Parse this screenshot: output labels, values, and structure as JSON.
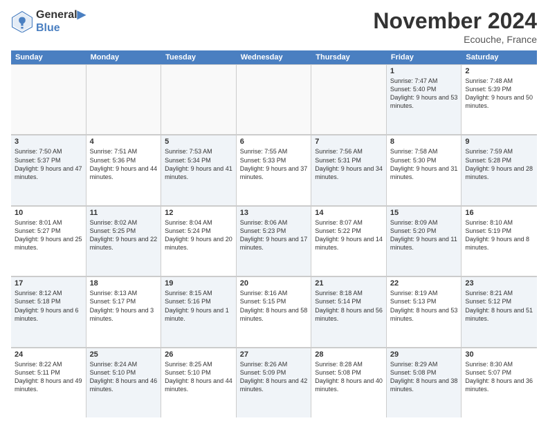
{
  "header": {
    "logo_line1": "General",
    "logo_line2": "Blue",
    "month_title": "November 2024",
    "location": "Ecouche, France"
  },
  "weekdays": [
    "Sunday",
    "Monday",
    "Tuesday",
    "Wednesday",
    "Thursday",
    "Friday",
    "Saturday"
  ],
  "weeks": [
    [
      {
        "day": "",
        "info": "",
        "empty": true
      },
      {
        "day": "",
        "info": "",
        "empty": true
      },
      {
        "day": "",
        "info": "",
        "empty": true
      },
      {
        "day": "",
        "info": "",
        "empty": true
      },
      {
        "day": "",
        "info": "",
        "empty": true
      },
      {
        "day": "1",
        "info": "Sunrise: 7:47 AM\nSunset: 5:40 PM\nDaylight: 9 hours and 53 minutes.",
        "empty": false,
        "shaded": true
      },
      {
        "day": "2",
        "info": "Sunrise: 7:48 AM\nSunset: 5:39 PM\nDaylight: 9 hours and 50 minutes.",
        "empty": false,
        "shaded": false
      }
    ],
    [
      {
        "day": "3",
        "info": "Sunrise: 7:50 AM\nSunset: 5:37 PM\nDaylight: 9 hours and 47 minutes.",
        "empty": false,
        "shaded": true
      },
      {
        "day": "4",
        "info": "Sunrise: 7:51 AM\nSunset: 5:36 PM\nDaylight: 9 hours and 44 minutes.",
        "empty": false,
        "shaded": false
      },
      {
        "day": "5",
        "info": "Sunrise: 7:53 AM\nSunset: 5:34 PM\nDaylight: 9 hours and 41 minutes.",
        "empty": false,
        "shaded": true
      },
      {
        "day": "6",
        "info": "Sunrise: 7:55 AM\nSunset: 5:33 PM\nDaylight: 9 hours and 37 minutes.",
        "empty": false,
        "shaded": false
      },
      {
        "day": "7",
        "info": "Sunrise: 7:56 AM\nSunset: 5:31 PM\nDaylight: 9 hours and 34 minutes.",
        "empty": false,
        "shaded": true
      },
      {
        "day": "8",
        "info": "Sunrise: 7:58 AM\nSunset: 5:30 PM\nDaylight: 9 hours and 31 minutes.",
        "empty": false,
        "shaded": false
      },
      {
        "day": "9",
        "info": "Sunrise: 7:59 AM\nSunset: 5:28 PM\nDaylight: 9 hours and 28 minutes.",
        "empty": false,
        "shaded": true
      }
    ],
    [
      {
        "day": "10",
        "info": "Sunrise: 8:01 AM\nSunset: 5:27 PM\nDaylight: 9 hours and 25 minutes.",
        "empty": false,
        "shaded": false
      },
      {
        "day": "11",
        "info": "Sunrise: 8:02 AM\nSunset: 5:25 PM\nDaylight: 9 hours and 22 minutes.",
        "empty": false,
        "shaded": true
      },
      {
        "day": "12",
        "info": "Sunrise: 8:04 AM\nSunset: 5:24 PM\nDaylight: 9 hours and 20 minutes.",
        "empty": false,
        "shaded": false
      },
      {
        "day": "13",
        "info": "Sunrise: 8:06 AM\nSunset: 5:23 PM\nDaylight: 9 hours and 17 minutes.",
        "empty": false,
        "shaded": true
      },
      {
        "day": "14",
        "info": "Sunrise: 8:07 AM\nSunset: 5:22 PM\nDaylight: 9 hours and 14 minutes.",
        "empty": false,
        "shaded": false
      },
      {
        "day": "15",
        "info": "Sunrise: 8:09 AM\nSunset: 5:20 PM\nDaylight: 9 hours and 11 minutes.",
        "empty": false,
        "shaded": true
      },
      {
        "day": "16",
        "info": "Sunrise: 8:10 AM\nSunset: 5:19 PM\nDaylight: 9 hours and 8 minutes.",
        "empty": false,
        "shaded": false
      }
    ],
    [
      {
        "day": "17",
        "info": "Sunrise: 8:12 AM\nSunset: 5:18 PM\nDaylight: 9 hours and 6 minutes.",
        "empty": false,
        "shaded": true
      },
      {
        "day": "18",
        "info": "Sunrise: 8:13 AM\nSunset: 5:17 PM\nDaylight: 9 hours and 3 minutes.",
        "empty": false,
        "shaded": false
      },
      {
        "day": "19",
        "info": "Sunrise: 8:15 AM\nSunset: 5:16 PM\nDaylight: 9 hours and 1 minute.",
        "empty": false,
        "shaded": true
      },
      {
        "day": "20",
        "info": "Sunrise: 8:16 AM\nSunset: 5:15 PM\nDaylight: 8 hours and 58 minutes.",
        "empty": false,
        "shaded": false
      },
      {
        "day": "21",
        "info": "Sunrise: 8:18 AM\nSunset: 5:14 PM\nDaylight: 8 hours and 56 minutes.",
        "empty": false,
        "shaded": true
      },
      {
        "day": "22",
        "info": "Sunrise: 8:19 AM\nSunset: 5:13 PM\nDaylight: 8 hours and 53 minutes.",
        "empty": false,
        "shaded": false
      },
      {
        "day": "23",
        "info": "Sunrise: 8:21 AM\nSunset: 5:12 PM\nDaylight: 8 hours and 51 minutes.",
        "empty": false,
        "shaded": true
      }
    ],
    [
      {
        "day": "24",
        "info": "Sunrise: 8:22 AM\nSunset: 5:11 PM\nDaylight: 8 hours and 49 minutes.",
        "empty": false,
        "shaded": false
      },
      {
        "day": "25",
        "info": "Sunrise: 8:24 AM\nSunset: 5:10 PM\nDaylight: 8 hours and 46 minutes.",
        "empty": false,
        "shaded": true
      },
      {
        "day": "26",
        "info": "Sunrise: 8:25 AM\nSunset: 5:10 PM\nDaylight: 8 hours and 44 minutes.",
        "empty": false,
        "shaded": false
      },
      {
        "day": "27",
        "info": "Sunrise: 8:26 AM\nSunset: 5:09 PM\nDaylight: 8 hours and 42 minutes.",
        "empty": false,
        "shaded": true
      },
      {
        "day": "28",
        "info": "Sunrise: 8:28 AM\nSunset: 5:08 PM\nDaylight: 8 hours and 40 minutes.",
        "empty": false,
        "shaded": false
      },
      {
        "day": "29",
        "info": "Sunrise: 8:29 AM\nSunset: 5:08 PM\nDaylight: 8 hours and 38 minutes.",
        "empty": false,
        "shaded": true
      },
      {
        "day": "30",
        "info": "Sunrise: 8:30 AM\nSunset: 5:07 PM\nDaylight: 8 hours and 36 minutes.",
        "empty": false,
        "shaded": false
      }
    ]
  ]
}
